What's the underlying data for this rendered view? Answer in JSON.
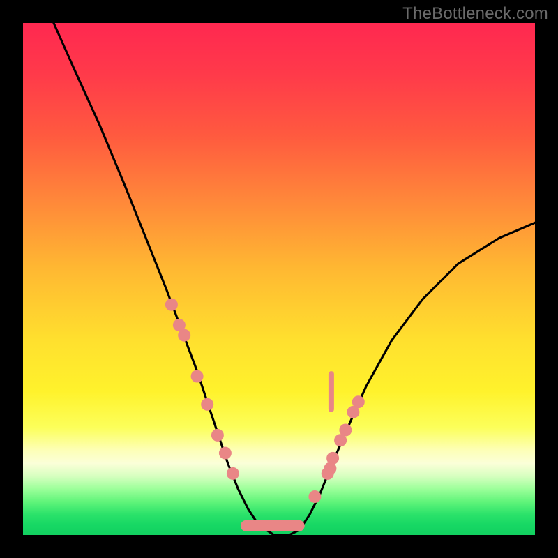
{
  "watermark": "TheBottleneck.com",
  "chart_data": {
    "type": "line",
    "title": "",
    "xlabel": "",
    "ylabel": "",
    "xlim": [
      0,
      100
    ],
    "ylim": [
      0,
      100
    ],
    "series": [
      {
        "name": "curve",
        "color": "#000000",
        "x": [
          6,
          10,
          15,
          20,
          24,
          28,
          31,
          34,
          36,
          38,
          40,
          42,
          44,
          46,
          49,
          52,
          54,
          56,
          58,
          60,
          63,
          67,
          72,
          78,
          85,
          93,
          100
        ],
        "y": [
          100,
          91,
          80,
          68,
          58,
          48,
          40,
          32,
          26,
          20,
          14,
          9,
          5,
          2,
          0,
          0,
          1,
          4,
          8,
          13,
          20,
          29,
          38,
          46,
          53,
          58,
          61
        ]
      },
      {
        "name": "dots-left",
        "color": "#e98686",
        "x": [
          29.0,
          30.5,
          31.5,
          34.0,
          36.0,
          38.0,
          39.5,
          41.0
        ],
        "y": [
          45.0,
          41.0,
          39.0,
          31.0,
          25.5,
          19.5,
          16.0,
          12.0
        ]
      },
      {
        "name": "dots-right",
        "color": "#e98686",
        "x": [
          57.0,
          59.5,
          60.0,
          60.5,
          62.0,
          63.0,
          64.5,
          65.5
        ],
        "y": [
          7.5,
          12.0,
          13.0,
          15.0,
          18.5,
          20.5,
          24.0,
          26.0
        ]
      },
      {
        "name": "bottom-band",
        "color": "#e98686",
        "x_range": [
          42.5,
          55.0
        ],
        "y": 1.8
      },
      {
        "name": "right-tick",
        "color": "#e98686",
        "x": 60.2,
        "y_range": [
          24.0,
          32.0
        ]
      }
    ]
  }
}
